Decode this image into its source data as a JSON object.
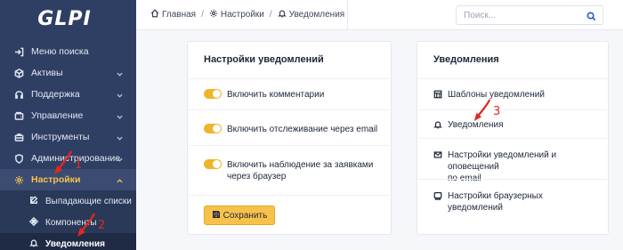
{
  "app": {
    "logo_text": "GLPI"
  },
  "sidebar": {
    "items": [
      {
        "label": "Меню поиска",
        "icon": "arrow-right-to-bracket-icon",
        "has_chevron": false
      },
      {
        "label": "Активы",
        "icon": "cube-icon",
        "has_chevron": true
      },
      {
        "label": "Поддержка",
        "icon": "headset-icon",
        "has_chevron": true
      },
      {
        "label": "Управление",
        "icon": "wallet-icon",
        "has_chevron": true
      },
      {
        "label": "Инструменты",
        "icon": "briefcase-icon",
        "has_chevron": true
      },
      {
        "label": "Администрирование",
        "icon": "shield-icon",
        "has_chevron": true
      },
      {
        "label": "Настройки",
        "icon": "gear-icon",
        "has_chevron": true,
        "active": true
      }
    ],
    "subitems": [
      {
        "label": "Выпадающие списки",
        "icon": "edit-icon"
      },
      {
        "label": "Компоненты",
        "icon": "puzzle-icon"
      },
      {
        "label": "Уведомления",
        "icon": "bell-icon",
        "current": true
      }
    ]
  },
  "topbar": {
    "breadcrumb": [
      {
        "label": "Главная",
        "icon": "home-icon"
      },
      {
        "label": "Настройки",
        "icon": "gear-icon"
      },
      {
        "label": "Уведомления",
        "icon": "bell-icon"
      }
    ],
    "separator": "/",
    "search": {
      "placeholder": "Поиск...",
      "value": ""
    }
  },
  "left_card": {
    "title": "Настройки уведомлений",
    "settings": [
      {
        "label": "Включить комментарии",
        "enabled": true
      },
      {
        "label": "Включить отслеживание через email",
        "enabled": true
      },
      {
        "label_line1": "Включить наблюдение за заявками",
        "label_line2": "через браузер",
        "enabled": true
      }
    ],
    "save_label": "Сохранить"
  },
  "right_card": {
    "title": "Уведомления",
    "links": [
      {
        "label": "Шаблоны уведомлений",
        "icon": "template-icon"
      },
      {
        "label": "Уведомления",
        "icon": "bell-icon"
      },
      {
        "label_line1": "Настройки уведомлений и оповещений",
        "label_line2": "по email",
        "icon": "envelope-icon"
      },
      {
        "label": "Настройки браузерных уведомлений",
        "icon": "browser-icon"
      }
    ]
  },
  "annotations": {
    "step1": "1",
    "step2": "2",
    "step3": "3",
    "color": "#e0281f"
  },
  "colors": {
    "sidebar_bg": "#2f3f64",
    "accent_yellow": "#f8c24a",
    "search_icon": "#2f5ec4"
  }
}
